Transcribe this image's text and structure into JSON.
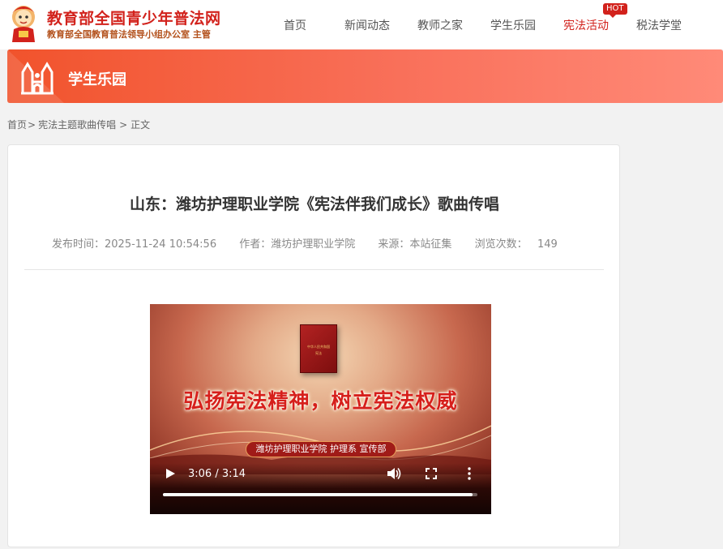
{
  "header": {
    "site_title": "教育部全国青少年普法网",
    "site_subtitle": "教育部全国教育普法领导小组办公室 主管",
    "nav": [
      {
        "label": "首页"
      },
      {
        "label": "新闻动态"
      },
      {
        "label": "教师之家"
      },
      {
        "label": "学生乐园"
      },
      {
        "label": "宪法活动",
        "active": true,
        "badge": "HOT"
      },
      {
        "label": "税法学堂"
      }
    ]
  },
  "banner": {
    "title": "学生乐园",
    "icon": "castle-icon"
  },
  "breadcrumb": {
    "home": "首页",
    "sep1": ">",
    "section": "宪法主题歌曲传唱",
    "sep2": ">",
    "current": "正文"
  },
  "article": {
    "title": "山东：潍坊护理职业学院《宪法伴我们成长》歌曲传唱",
    "meta": {
      "publish_label": "发布时间：",
      "publish_time": "2025-11-24 10:54:56",
      "author_label": "作者：",
      "author": "潍坊护理职业学院",
      "source_label": "来源：",
      "source": "本站征集",
      "views_label": "浏览次数：",
      "views": "149"
    }
  },
  "video": {
    "book_line1": "中华人民共和国",
    "book_line2": "宪法",
    "slogan": "弘扬宪法精神，树立宪法权威",
    "caption": "潍坊护理职业学院 护理系 宣传部",
    "time": "3:06 / 3:14",
    "progress": 0.9845,
    "icons": {
      "play": "play-icon",
      "volume": "volume-icon",
      "fullscreen": "fullscreen-icon",
      "more": "more-vertical-icon"
    }
  },
  "colors": {
    "brand_red": "#d2221c",
    "banner_orange": "#f1532c"
  }
}
